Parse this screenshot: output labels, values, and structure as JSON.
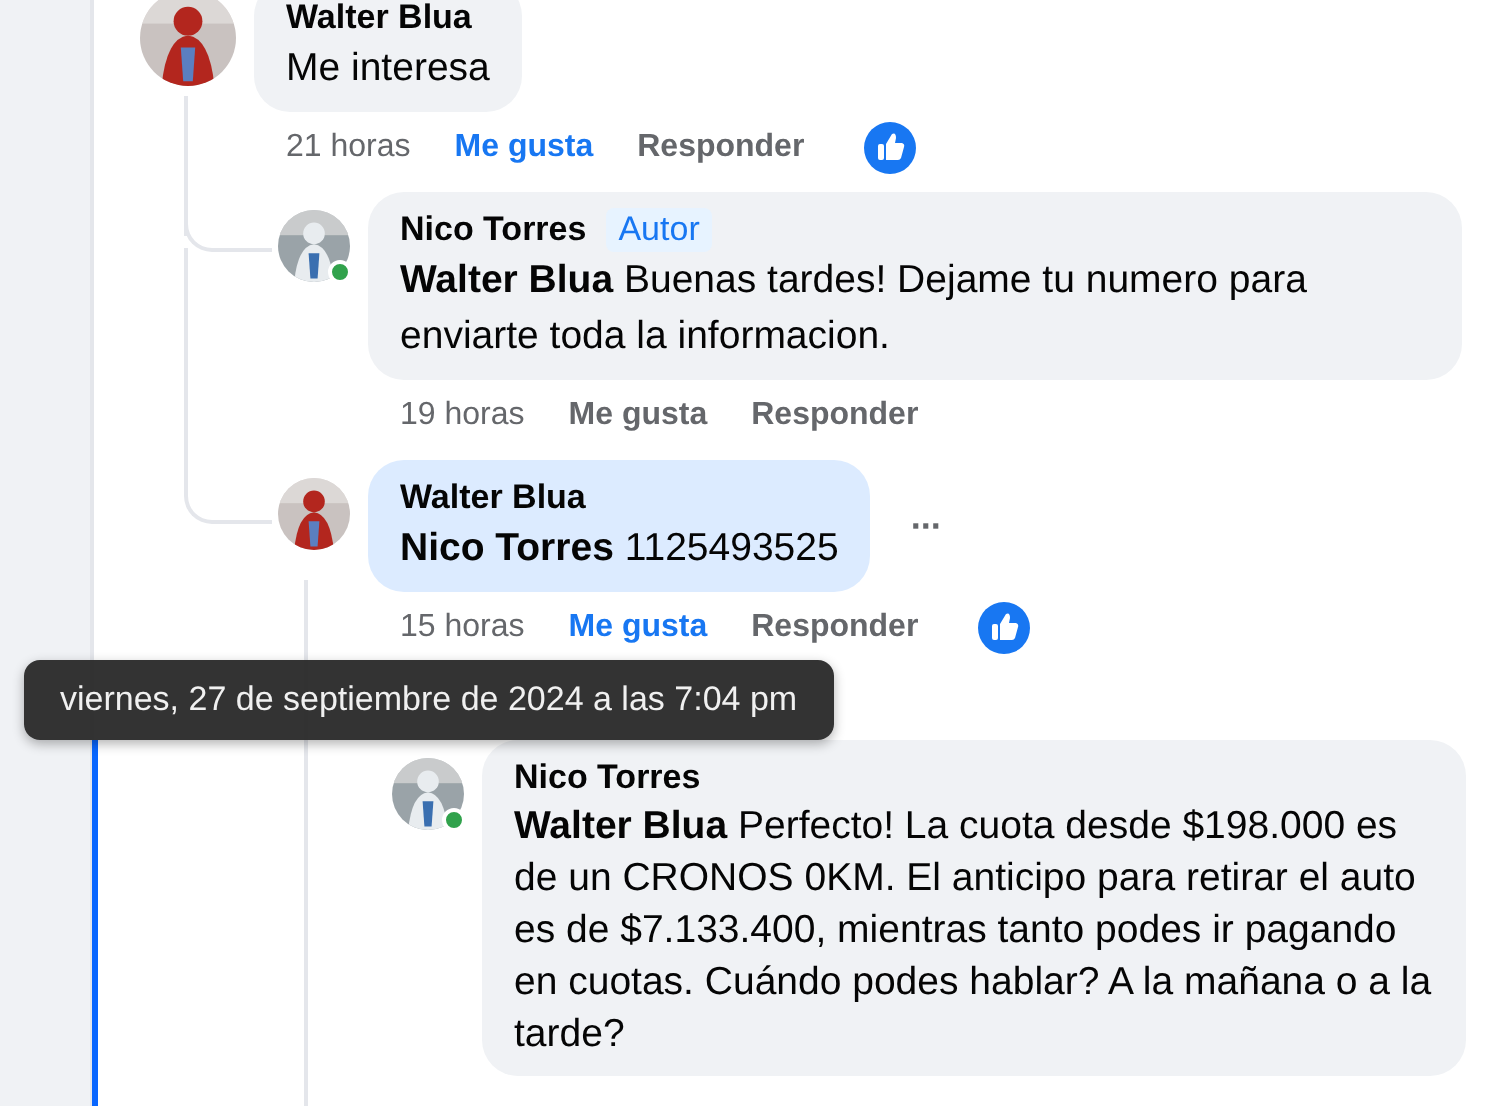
{
  "comments": [
    {
      "author": "Walter Blua",
      "text": "Me interesa",
      "time": "21 horas",
      "like_label": "Me gusta",
      "reply_label": "Responder",
      "liked": true,
      "reaction": true,
      "highlighted": false,
      "online": false,
      "replies": [
        {
          "author": "Nico Torres",
          "badge": "Autor",
          "mention": "Walter Blua",
          "text": "Buenas tardes! Dejame tu numero para enviarte toda la informacion.",
          "time": "19 horas",
          "like_label": "Me gusta",
          "reply_label": "Responder",
          "liked": false,
          "reaction": false,
          "highlighted": false,
          "online": true
        },
        {
          "author": "Walter Blua",
          "mention": "Nico Torres",
          "text": "1125493525",
          "time": "15 horas",
          "like_label": "Me gusta",
          "reply_label": "Responder",
          "liked": true,
          "reaction": true,
          "highlighted": true,
          "online": false,
          "more": "···",
          "replies": [
            {
              "author": "Nico Torres",
              "mention": "Walter Blua",
              "text": "Perfecto! La cuota desde $198.000 es de un CRONOS 0KM. El anticipo para retirar el auto es de $7.133.400, mientras tanto podes ir pagando en cuotas. Cuándo podes hablar? A la mañana o a la tarde?",
              "highlighted": false,
              "online": true
            }
          ]
        }
      ]
    }
  ],
  "tooltip": "viernes, 27 de septiembre de 2024 a las 7:04 pm"
}
